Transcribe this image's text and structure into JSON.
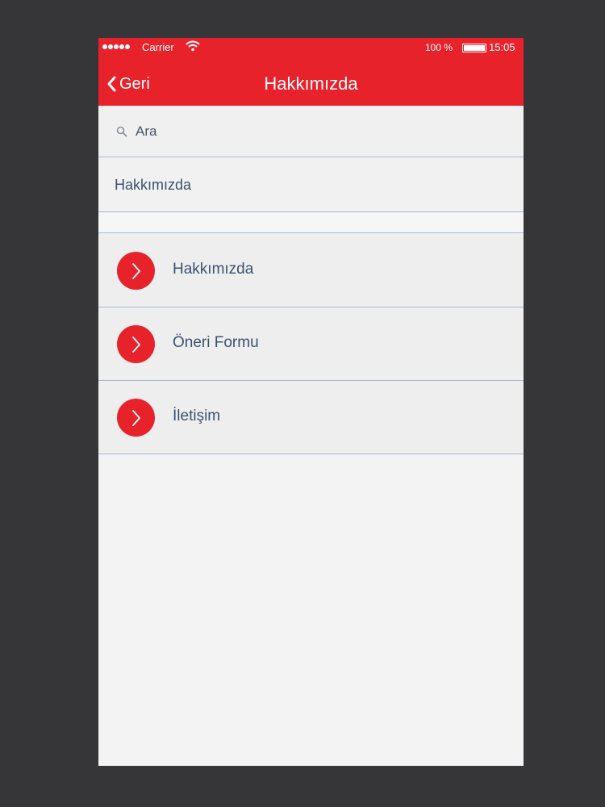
{
  "colors": {
    "accent": "#e8222b",
    "background": "#363537",
    "text": "#3d516e",
    "divider": "#a9b7cb"
  },
  "status_bar": {
    "carrier": "Carrier",
    "battery": "100 %",
    "time": "15:05"
  },
  "nav": {
    "back_label": "Geri",
    "title": "Hakkımızda"
  },
  "search": {
    "placeholder": "Ara"
  },
  "section": {
    "title": "Hakkımızda"
  },
  "menu": {
    "items": [
      {
        "label": "Hakkımızda",
        "icon": "chevron-right-icon"
      },
      {
        "label": "Öneri Formu",
        "icon": "chevron-right-icon"
      },
      {
        "label": "İletişim",
        "icon": "chevron-right-icon"
      }
    ]
  }
}
